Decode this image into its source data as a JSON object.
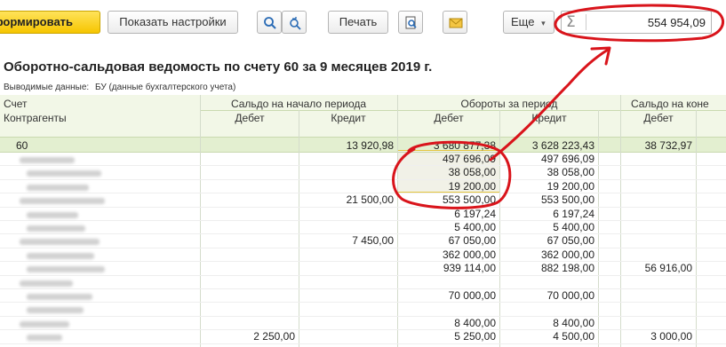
{
  "toolbar": {
    "generate_label": "Сформировать",
    "settings_label": "Показать настройки",
    "print_label": "Печать",
    "more_label": "Еще",
    "more_arrow": "▾",
    "sum_symbol": "Σ",
    "sum_value": "554 954,09"
  },
  "report": {
    "title": "Оборотно-сальдовая ведомость по счету 60 за 9 месяцев 2019 г.",
    "output_label": "Выводимые данные:",
    "output_value": "БУ (данные бухгалтерского учета)"
  },
  "table": {
    "col_account": "Счет",
    "col_counterparties": "Контрагенты",
    "group_opening": "Сальдо на начало периода",
    "group_turnover": "Обороты за период",
    "group_closing": "Сальдо на коне",
    "debit": "Дебет",
    "credit": "Кредит",
    "total_row": {
      "account": "60",
      "opening_debit": "",
      "opening_credit": "13 920,98",
      "turnover_debit": "3 680 877,38",
      "turnover_credit": "3 628 223,43",
      "closing_debit": "38 732,97"
    },
    "rows": [
      {
        "opening_debit": "",
        "opening_credit": "",
        "turnover_debit": "497 696,09",
        "turnover_credit": "497 696,09",
        "closing_debit": ""
      },
      {
        "opening_debit": "",
        "opening_credit": "",
        "turnover_debit": "38 058,00",
        "turnover_credit": "38 058,00",
        "closing_debit": ""
      },
      {
        "opening_debit": "",
        "opening_credit": "",
        "turnover_debit": "19 200,00",
        "turnover_credit": "19 200,00",
        "closing_debit": ""
      },
      {
        "opening_debit": "",
        "opening_credit": "21 500,00",
        "turnover_debit": "553 500,00",
        "turnover_credit": "553 500,00",
        "closing_debit": ""
      },
      {
        "opening_debit": "",
        "opening_credit": "",
        "turnover_debit": "6 197,24",
        "turnover_credit": "6 197,24",
        "closing_debit": ""
      },
      {
        "opening_debit": "",
        "opening_credit": "",
        "turnover_debit": "5 400,00",
        "turnover_credit": "5 400,00",
        "closing_debit": ""
      },
      {
        "opening_debit": "",
        "opening_credit": "7 450,00",
        "turnover_debit": "67 050,00",
        "turnover_credit": "67 050,00",
        "closing_debit": ""
      },
      {
        "opening_debit": "",
        "opening_credit": "",
        "turnover_debit": "362 000,00",
        "turnover_credit": "362 000,00",
        "closing_debit": ""
      },
      {
        "opening_debit": "",
        "opening_credit": "",
        "turnover_debit": "939 114,00",
        "turnover_credit": "882 198,00",
        "closing_debit": "56 916,00"
      },
      {
        "opening_debit": "",
        "opening_credit": "",
        "turnover_debit": "",
        "turnover_credit": "",
        "closing_debit": ""
      },
      {
        "opening_debit": "",
        "opening_credit": "",
        "turnover_debit": "70 000,00",
        "turnover_credit": "70 000,00",
        "closing_debit": ""
      },
      {
        "opening_debit": "",
        "opening_credit": "",
        "turnover_debit": "",
        "turnover_credit": "",
        "closing_debit": ""
      },
      {
        "opening_debit": "",
        "opening_credit": "",
        "turnover_debit": "8 400,00",
        "turnover_credit": "8 400,00",
        "closing_debit": ""
      },
      {
        "opening_debit": "2 250,00",
        "opening_credit": "",
        "turnover_debit": "5 250,00",
        "turnover_credit": "4 500,00",
        "closing_debit": "3 000,00"
      }
    ]
  },
  "colors": {
    "accent_yellow": "#f6c500",
    "header_bg": "#f2f7e7",
    "total_row_bg": "#e3efd0",
    "annotation_red": "#d9141b"
  }
}
